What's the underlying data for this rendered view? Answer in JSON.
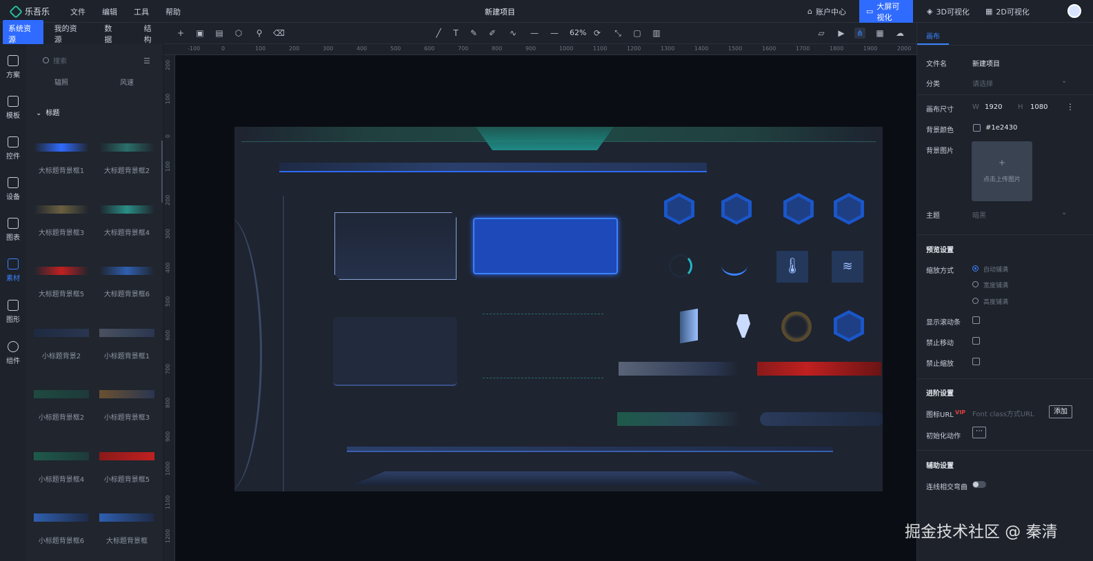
{
  "app": {
    "name": "乐吾乐",
    "project_title": "新建项目"
  },
  "menu": [
    "文件",
    "编辑",
    "工具",
    "帮助"
  ],
  "top_right": {
    "account": "账户中心",
    "bigscreen": "大屏可视化",
    "vis3d": "3D可视化",
    "vis2d": "2D可视化"
  },
  "left_tabs": [
    "系统资源",
    "我的资源",
    "数据",
    "结构"
  ],
  "nav": [
    "方案",
    "模板",
    "控件",
    "设备",
    "图表",
    "素材",
    "图形",
    "组件"
  ],
  "library": {
    "search_placeholder": "搜索",
    "row0": [
      "辐照",
      "风速"
    ],
    "group_title": "标题",
    "items": [
      "大标题背景框1",
      "大标题背景框2",
      "大标题背景框3",
      "大标题背景框4",
      "大标题背景框5",
      "大标题背景框6",
      "小标题背景2",
      "小标题背景框1",
      "小标题背景框2",
      "小标题背景框3",
      "小标题背景框4",
      "小标题背景框5",
      "小标题背景框6",
      "大标题背景框"
    ]
  },
  "toolbar": {
    "zoom": "62%"
  },
  "ruler_h": [
    "-100",
    "0",
    "100",
    "200",
    "300",
    "400",
    "500",
    "600",
    "700",
    "800",
    "900",
    "1000",
    "1100",
    "1200",
    "1300",
    "1400",
    "1500",
    "1600",
    "1700",
    "1800",
    "1900",
    "2000"
  ],
  "ruler_v": [
    "200",
    "100",
    "0",
    "100",
    "200",
    "300",
    "400",
    "500",
    "600",
    "700",
    "800",
    "900",
    "1000",
    "1100",
    "1200"
  ],
  "right_panel": {
    "tab": "画布",
    "file_name_label": "文件名",
    "file_name": "新建项目",
    "category_label": "分类",
    "category_placeholder": "请选择",
    "canvas_size_label": "画布尺寸",
    "w_label": "W",
    "w": "1920",
    "h_label": "H",
    "h": "1080",
    "bg_color_label": "背景颜色",
    "bg_color": "#1e2430",
    "bg_image_label": "背景图片",
    "upload_text": "点击上传图片",
    "theme_label": "主题",
    "theme_placeholder": "暗黑",
    "preview_title": "预览设置",
    "scale_label": "缩放方式",
    "scale_options": [
      "自动铺满",
      "宽度铺满",
      "高度铺满"
    ],
    "show_scroll": "显示滚动条",
    "no_move": "禁止移动",
    "no_scale": "禁止缩放",
    "advanced_title": "进阶设置",
    "icon_url_label": "图标URL",
    "vip": "VIP",
    "icon_url_placeholder": "Font class方式URL",
    "add": "添加",
    "init_action_label": "初始化动作",
    "assist_title": "辅助设置",
    "curve_label": "连线相交弯曲"
  },
  "watermark": "掘金技术社区 @ 秦清",
  "colors": {
    "accent": "#2f6bff",
    "canvas_bg": "#1e2430",
    "workspace": "#0a0e14"
  }
}
